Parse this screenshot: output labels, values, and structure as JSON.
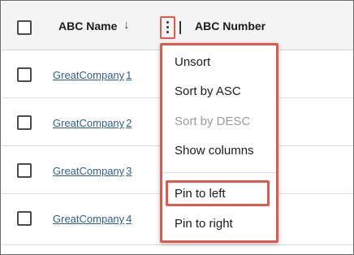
{
  "header": {
    "select_all_checked": false,
    "col_name": "ABC Name",
    "sort_arrow": "↓",
    "col_number": "ABC Number"
  },
  "rows": [
    {
      "name": "GreatCompany",
      "num": "1"
    },
    {
      "name": "GreatCompany",
      "num": "2"
    },
    {
      "name": "GreatCompany",
      "num": "3"
    },
    {
      "name": "GreatCompany",
      "num": "4"
    }
  ],
  "menu": {
    "items": [
      {
        "label": "Unsort",
        "disabled": false
      },
      {
        "label": "Sort by ASC",
        "disabled": false
      },
      {
        "label": "Sort by DESC",
        "disabled": true
      },
      {
        "label": "Show columns",
        "disabled": false
      },
      {
        "label": "Pin to left",
        "disabled": false,
        "highlighted": true
      },
      {
        "label": "Pin to right",
        "disabled": false
      }
    ]
  },
  "colors": {
    "highlight": "#e05a4c",
    "link": "#2f5f8a",
    "header_bg": "#f4f4f4"
  }
}
